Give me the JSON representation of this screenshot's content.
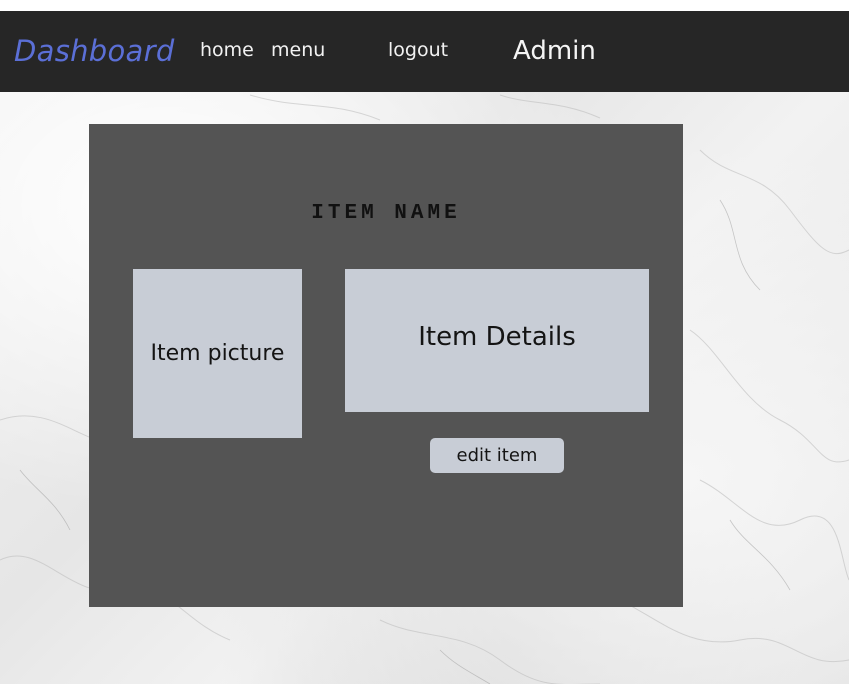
{
  "navbar": {
    "brand": "Dashboard",
    "links": {
      "home": "home",
      "menu": "menu",
      "logout": "logout"
    },
    "user": "Admin"
  },
  "item": {
    "name": "ITEM NAME",
    "picture_label": "Item picture",
    "details_label": "Item Details",
    "edit_button": "edit item"
  },
  "colors": {
    "navbar_bg": "#262626",
    "brand": "#5b6fd6",
    "panel_bg": "#545454",
    "card_bg": "#c8cdd6"
  }
}
